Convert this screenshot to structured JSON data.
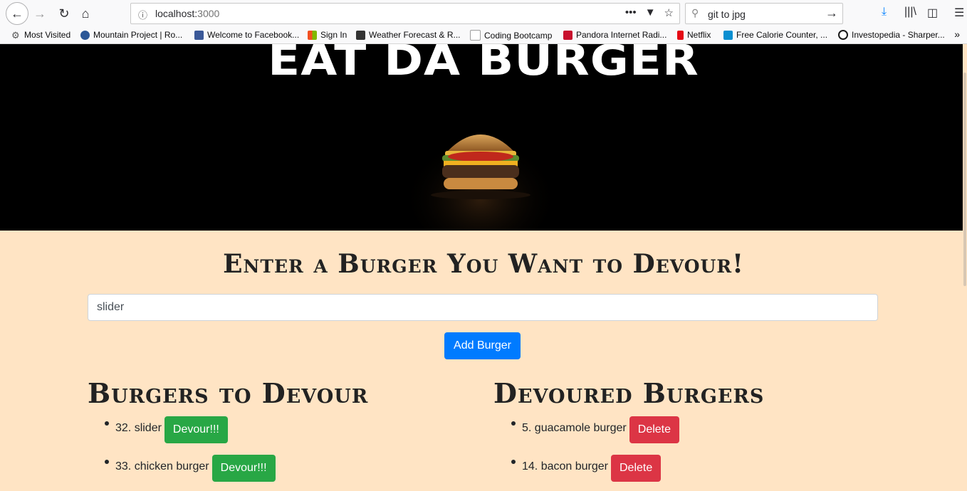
{
  "browser": {
    "url_host": "localhost:",
    "url_port": "3000",
    "search_query": "git to jpg",
    "bookmarks": [
      {
        "label": "Most Visited",
        "icon": "gear-icon",
        "color": "#555555"
      },
      {
        "label": "Mountain Project | Ro...",
        "icon": "mountain-icon",
        "color": "#2b5797"
      },
      {
        "label": "Welcome to Facebook...",
        "icon": "facebook-icon",
        "color": "#3b5998"
      },
      {
        "label": "Sign In",
        "icon": "microsoft-icon",
        "color": "#f25022"
      },
      {
        "label": "Weather Forecast & R...",
        "icon": "weather-icon",
        "color": "#333333"
      },
      {
        "label": "Coding Bootcamp",
        "icon": "folder-icon",
        "color": "#9e9e9e"
      },
      {
        "label": "Pandora Internet Radi...",
        "icon": "pandora-icon",
        "color": "#c8102e"
      },
      {
        "label": "Netflix",
        "icon": "netflix-icon",
        "color": "#e50914"
      },
      {
        "label": "Free Calorie Counter, ...",
        "icon": "calorie-icon",
        "color": "#0a8fd1"
      },
      {
        "label": "Investopedia - Sharper...",
        "icon": "investopedia-icon",
        "color": "#1a1a1a"
      }
    ]
  },
  "page": {
    "hero_title": "EAT DA BURGER",
    "form_title": "Enter a Burger You Want to Devour!",
    "input_value": "slider",
    "add_button": "Add Burger",
    "to_devour_title": "Burgers to Devour",
    "devoured_title": "Devoured Burgers",
    "to_devour": [
      {
        "text": "32. slider",
        "button": "Devour!!!"
      },
      {
        "text": "33. chicken burger",
        "button": "Devour!!!"
      }
    ],
    "devoured": [
      {
        "text": "5. guacamole burger",
        "button": "Delete"
      },
      {
        "text": "14. bacon burger",
        "button": "Delete"
      }
    ]
  }
}
